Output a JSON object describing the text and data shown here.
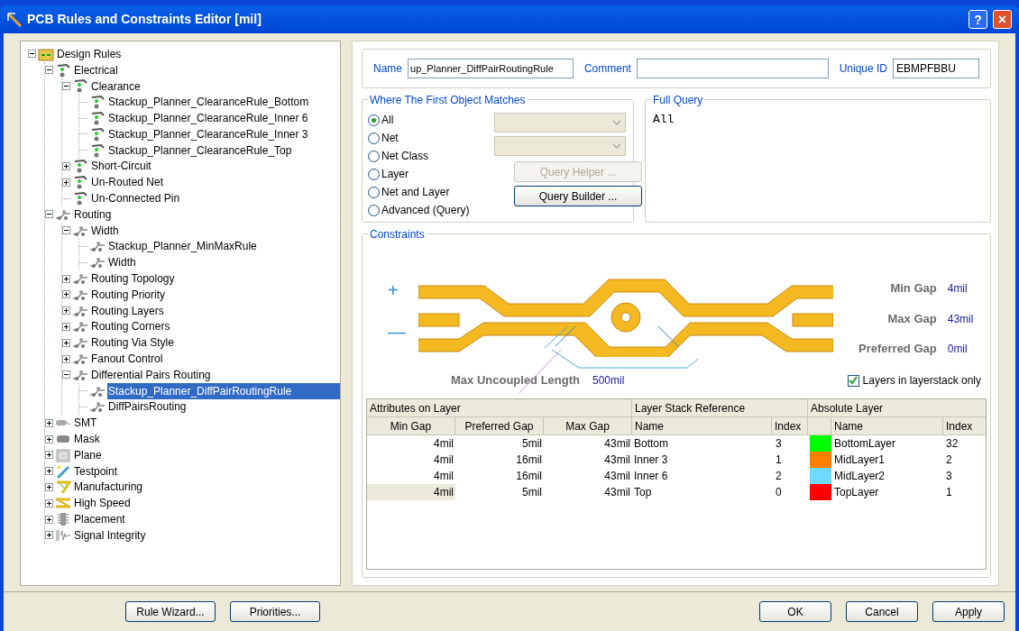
{
  "window": {
    "title": "PCB Rules and Constraints Editor [mil]",
    "help_glyph": "?",
    "close_glyph": "×"
  },
  "tree": [
    {
      "label": "Design Rules",
      "kind": "root",
      "leaf": false,
      "expanded": true,
      "selected": false,
      "children": [
        {
          "label": "Electrical",
          "kind": "electrical",
          "leaf": false,
          "expanded": true,
          "selected": false,
          "children": [
            {
              "label": "Clearance",
              "kind": "electrical",
              "leaf": false,
              "expanded": true,
              "selected": false,
              "children": [
                {
                  "label": "Stackup_Planner_ClearanceRule_Bottom",
                  "kind": "electrical",
                  "leaf": true,
                  "selected": false
                },
                {
                  "label": "Stackup_Planner_ClearanceRule_Inner 6",
                  "kind": "electrical",
                  "leaf": true,
                  "selected": false
                },
                {
                  "label": "Stackup_Planner_ClearanceRule_Inner 3",
                  "kind": "electrical",
                  "leaf": true,
                  "selected": false
                },
                {
                  "label": "Stackup_Planner_ClearanceRule_Top",
                  "kind": "electrical",
                  "leaf": true,
                  "selected": false
                }
              ]
            },
            {
              "label": "Short-Circuit",
              "kind": "electrical",
              "leaf": false,
              "expanded": false,
              "selected": false
            },
            {
              "label": "Un-Routed Net",
              "kind": "electrical",
              "leaf": false,
              "expanded": false,
              "selected": false
            },
            {
              "label": "Un-Connected Pin",
              "kind": "electrical",
              "leaf": true,
              "selected": false
            }
          ]
        },
        {
          "label": "Routing",
          "kind": "routing",
          "leaf": false,
          "expanded": true,
          "selected": false,
          "children": [
            {
              "label": "Width",
              "kind": "routing",
              "leaf": false,
              "expanded": true,
              "selected": false,
              "children": [
                {
                  "label": "Stackup_Planner_MinMaxRule",
                  "kind": "routing",
                  "leaf": true,
                  "selected": false
                },
                {
                  "label": "Width",
                  "kind": "routing",
                  "leaf": true,
                  "selected": false
                }
              ]
            },
            {
              "label": "Routing Topology",
              "kind": "routing",
              "leaf": false,
              "expanded": false,
              "selected": false
            },
            {
              "label": "Routing Priority",
              "kind": "routing",
              "leaf": false,
              "expanded": false,
              "selected": false
            },
            {
              "label": "Routing Layers",
              "kind": "routing",
              "leaf": false,
              "expanded": false,
              "selected": false
            },
            {
              "label": "Routing Corners",
              "kind": "routing",
              "leaf": false,
              "expanded": false,
              "selected": false
            },
            {
              "label": "Routing Via Style",
              "kind": "routing",
              "leaf": false,
              "expanded": false,
              "selected": false
            },
            {
              "label": "Fanout Control",
              "kind": "routing",
              "leaf": false,
              "expanded": false,
              "selected": false
            },
            {
              "label": "Differential Pairs Routing",
              "kind": "routing",
              "leaf": false,
              "expanded": true,
              "selected": false,
              "children": [
                {
                  "label": "Stackup_Planner_DiffPairRoutingRule",
                  "kind": "routing",
                  "leaf": true,
                  "selected": true
                },
                {
                  "label": "DiffPairsRouting",
                  "kind": "routing",
                  "leaf": true,
                  "selected": false
                }
              ]
            }
          ]
        },
        {
          "label": "SMT",
          "kind": "smt",
          "leaf": false,
          "expanded": false,
          "selected": false
        },
        {
          "label": "Mask",
          "kind": "mask",
          "leaf": false,
          "expanded": false,
          "selected": false
        },
        {
          "label": "Plane",
          "kind": "plane",
          "leaf": false,
          "expanded": false,
          "selected": false
        },
        {
          "label": "Testpoint",
          "kind": "testpoint",
          "leaf": false,
          "expanded": false,
          "selected": false
        },
        {
          "label": "Manufacturing",
          "kind": "manufacturing",
          "leaf": false,
          "expanded": false,
          "selected": false
        },
        {
          "label": "High Speed",
          "kind": "highspeed",
          "leaf": false,
          "expanded": false,
          "selected": false
        },
        {
          "label": "Placement",
          "kind": "placement",
          "leaf": false,
          "expanded": false,
          "selected": false
        },
        {
          "label": "Signal Integrity",
          "kind": "signal",
          "leaf": false,
          "expanded": false,
          "selected": false
        }
      ]
    }
  ],
  "rule": {
    "name_label": "Name",
    "name_value": "up_Planner_DiffPairRoutingRule",
    "comment_label": "Comment",
    "uid_label": "Unique ID",
    "uid_value": "EBMPFBBU"
  },
  "match": {
    "title": "Where The First Object Matches",
    "options": [
      {
        "label": "All",
        "selected": true
      },
      {
        "label": "Net",
        "selected": false
      },
      {
        "label": "Net Class",
        "selected": false
      },
      {
        "label": "Layer",
        "selected": false
      },
      {
        "label": "Net and Layer",
        "selected": false
      },
      {
        "label": "Advanced (Query)",
        "selected": false
      }
    ],
    "helper_button": {
      "label": "Query Helper ...",
      "disabled": true
    },
    "builder_button": {
      "label": "Query Builder ...",
      "disabled": false
    }
  },
  "full_query": {
    "title": "Full Query",
    "text": "All"
  },
  "constraints": {
    "title": "Constraints",
    "plus": "+",
    "minus": "—",
    "gaps": [
      {
        "label": "Min Gap",
        "value": "4mil"
      },
      {
        "label": "Max Gap",
        "value": "43mil"
      },
      {
        "label": "Preferred Gap",
        "value": "0mil"
      }
    ],
    "uncoupled_label": "Max Uncoupled Length",
    "uncoupled_value": "500mil",
    "layers_only": {
      "label": "Layers in layerstack only",
      "checked": true
    }
  },
  "table": {
    "groups": [
      "Attributes on Layer",
      "Layer Stack Reference",
      "Absolute Layer"
    ],
    "columns": [
      "Min Gap",
      "Preferred Gap",
      "Max Gap",
      "Name",
      "Index",
      "Name",
      "Index"
    ],
    "rows": [
      {
        "min": "4mil",
        "pref": "5mil",
        "max": "43mil",
        "ref_name": "Bottom",
        "ref_index": "3",
        "color": "#00ff00",
        "abs_name": "BottomLayer",
        "abs_index": "32",
        "selected": false
      },
      {
        "min": "4mil",
        "pref": "16mil",
        "max": "43mil",
        "ref_name": "Inner 3",
        "ref_index": "1",
        "color": "#ff8000",
        "abs_name": "MidLayer1",
        "abs_index": "2",
        "selected": false
      },
      {
        "min": "4mil",
        "pref": "16mil",
        "max": "43mil",
        "ref_name": "Inner 6",
        "ref_index": "2",
        "color": "#6ed9ff",
        "abs_name": "MidLayer2",
        "abs_index": "3",
        "selected": false
      },
      {
        "min": "4mil",
        "pref": "5mil",
        "max": "43mil",
        "ref_name": "Top",
        "ref_index": "0",
        "color": "#ff0000",
        "abs_name": "TopLayer",
        "abs_index": "1",
        "selected": true
      }
    ]
  },
  "buttons": {
    "left": [
      "Rule Wizard...",
      "Priorities..."
    ],
    "right": [
      "OK",
      "Cancel",
      "Apply"
    ]
  }
}
